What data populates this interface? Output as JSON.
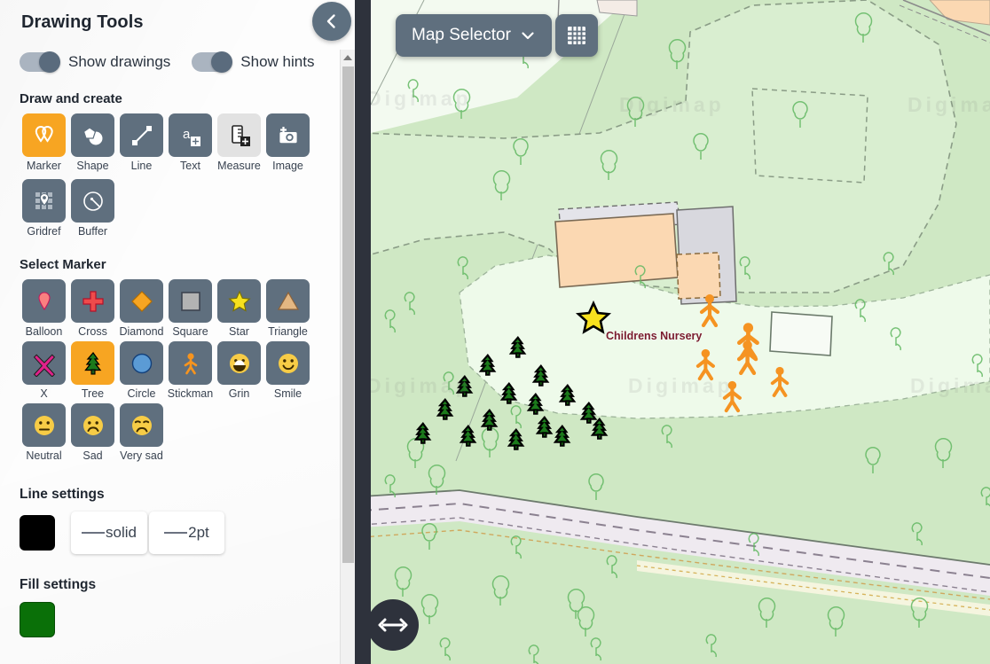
{
  "panel": {
    "title": "Drawing Tools",
    "collapse_icon": "chevron-left-icon",
    "toggles": [
      {
        "label": "Show drawings",
        "on": true
      },
      {
        "label": "Show hints",
        "on": true
      }
    ],
    "draw_section": {
      "heading": "Draw and create",
      "tools": [
        {
          "label": "Marker",
          "icon": "marker-pins-icon",
          "state": "active"
        },
        {
          "label": "Shape",
          "icon": "shapes-icon",
          "state": "normal"
        },
        {
          "label": "Line",
          "icon": "line-icon",
          "state": "normal"
        },
        {
          "label": "Text",
          "icon": "text-add-icon",
          "state": "normal"
        },
        {
          "label": "Measure",
          "icon": "ruler-add-icon",
          "state": "disabled"
        },
        {
          "label": "Image",
          "icon": "camera-add-icon",
          "state": "normal"
        },
        {
          "label": "Gridref",
          "icon": "gridref-icon",
          "state": "normal"
        },
        {
          "label": "Buffer",
          "icon": "buffer-icon",
          "state": "normal"
        }
      ]
    },
    "marker_section": {
      "heading": "Select Marker",
      "markers": [
        {
          "label": "Balloon",
          "icon": "balloon-marker-icon",
          "state": "normal"
        },
        {
          "label": "Cross",
          "icon": "cross-marker-icon",
          "state": "normal"
        },
        {
          "label": "Diamond",
          "icon": "diamond-marker-icon",
          "state": "normal"
        },
        {
          "label": "Square",
          "icon": "square-marker-icon",
          "state": "normal"
        },
        {
          "label": "Star",
          "icon": "star-marker-icon",
          "state": "normal"
        },
        {
          "label": "Triangle",
          "icon": "triangle-marker-icon",
          "state": "normal"
        },
        {
          "label": "X",
          "icon": "x-marker-icon",
          "state": "normal"
        },
        {
          "label": "Tree",
          "icon": "tree-marker-icon",
          "state": "active"
        },
        {
          "label": "Circle",
          "icon": "circle-marker-icon",
          "state": "normal"
        },
        {
          "label": "Stickman",
          "icon": "stickman-marker-icon",
          "state": "normal"
        },
        {
          "label": "Grin",
          "icon": "grin-marker-icon",
          "state": "normal"
        },
        {
          "label": "Smile",
          "icon": "smile-marker-icon",
          "state": "normal"
        },
        {
          "label": "Neutral",
          "icon": "neutral-marker-icon",
          "state": "normal"
        },
        {
          "label": "Sad",
          "icon": "sad-marker-icon",
          "state": "normal"
        },
        {
          "label": "Very sad",
          "icon": "very-sad-marker-icon",
          "state": "normal"
        }
      ]
    },
    "line_settings": {
      "heading": "Line settings",
      "color": "#000000",
      "style_label": "solid",
      "width_label": "2pt"
    },
    "fill_settings": {
      "heading": "Fill settings",
      "color": "#0a7008"
    },
    "scrollbar": {
      "up_arrow_icon": "caret-up-icon"
    }
  },
  "map": {
    "selector_label": "Map Selector",
    "selector_caret_icon": "chevron-down-icon",
    "grid_button_icon": "grid-icon",
    "resize_handle_icon": "horizontal-resize-icon",
    "annotation_label": "Childrens Nursery",
    "annotation_label_color": "#7a1b2e",
    "star_marker_color": "#f7e11e",
    "stickman_color": "#f59322",
    "tree_color": "#1b6b1b",
    "watermarks": [
      "Digimap",
      "Digimap",
      "Digimap",
      "Digimap",
      "Digimap",
      "Digimap"
    ],
    "colors": {
      "grass": "#cfe8c4",
      "grass_light": "#eaf7e3",
      "building_orange": "#fbd8b2",
      "building_grey": "#d8d8de",
      "path": "#efeaf0"
    }
  }
}
